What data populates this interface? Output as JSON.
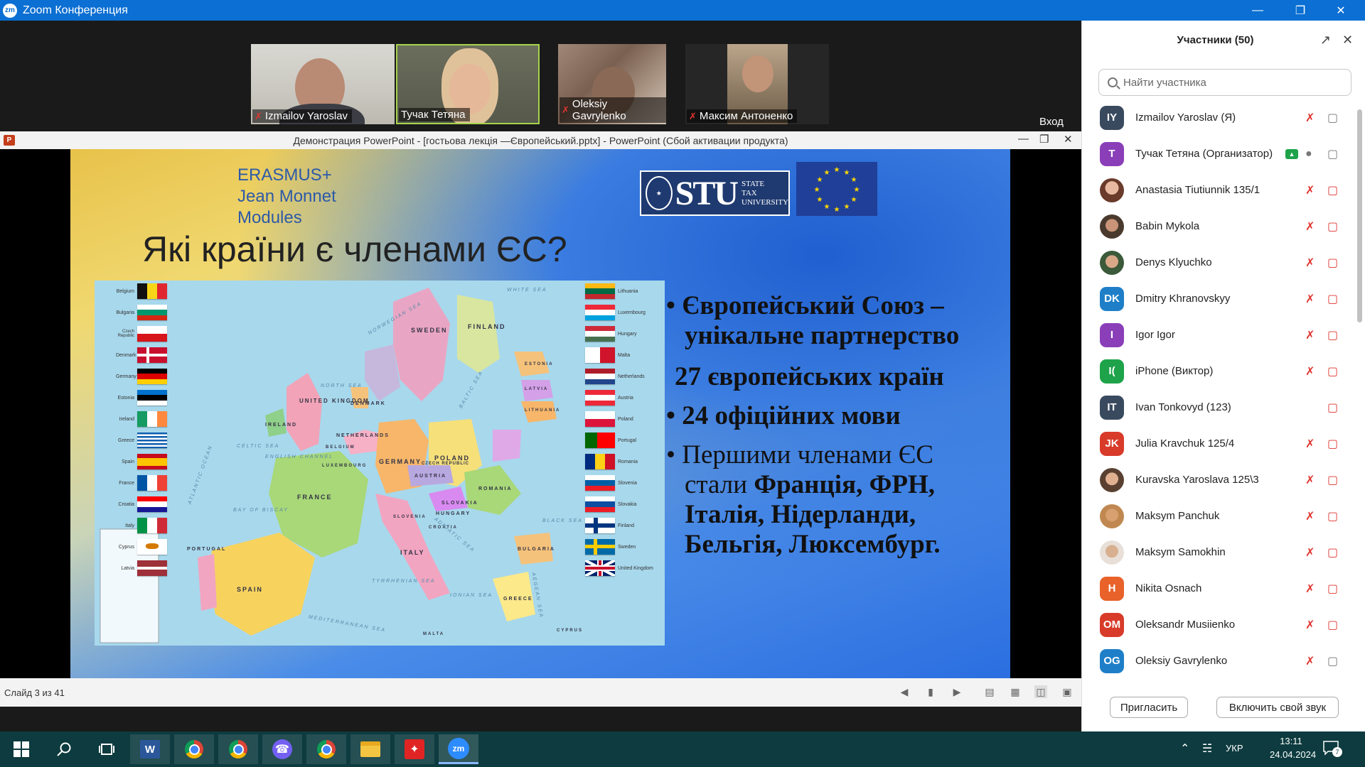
{
  "window": {
    "title": "Zoom Конференция",
    "logo": "zm"
  },
  "videos": [
    {
      "name": "Izmailov Yaroslav",
      "muted": true
    },
    {
      "name": "Тучак Тетяна",
      "muted": false
    },
    {
      "name": "Oleksiy Gavrylenko",
      "muted": true
    },
    {
      "name": "Максим Антоненко",
      "muted": true
    }
  ],
  "vhod_label": "Вход",
  "ppt": {
    "window_title": "Демонстрация PowerPoint - [гостьова лекція —Європейський.pptx] - PowerPoint (Сбой активации продукта)",
    "status": "Слайд 3 из 41"
  },
  "slide": {
    "erasmus_lines": [
      "ERASMUS+",
      "Jean Monnet",
      "Modules"
    ],
    "title": "Які країни є членами ЄС?",
    "logo": {
      "big": "STU",
      "small": [
        "STATE",
        "TAX",
        "UNIVERSITY"
      ]
    },
    "bullets": [
      {
        "marker": "•",
        "lines": [
          "Європейський Союз –",
          "унікальне партнерство"
        ]
      },
      {
        "marker": "",
        "lines": [
          "27 європейських країн"
        ]
      },
      {
        "marker": "•",
        "lines": [
          "24 офіційних мови"
        ]
      },
      {
        "marker": "•",
        "lines_plain": [
          "Першими членами ЄС",
          "стали "
        ],
        "bold_parts": [
          "Франція, ФРН,",
          "Італія, Нідерланди,",
          "Бельгія, Люксембург."
        ]
      }
    ],
    "flags_left": [
      "Belgium",
      "Bulgaria",
      "Czech Republic",
      "Denmark",
      "Germany",
      "Estonia",
      "Ireland",
      "Greece",
      "Spain",
      "France",
      "Croatia",
      "Italy",
      "Cyprus",
      "Latvia"
    ],
    "flags_right": [
      "Lithuania",
      "Luxembourg",
      "Hungary",
      "Malta",
      "Netherlands",
      "Austria",
      "Poland",
      "Portugal",
      "Romania",
      "Slovenia",
      "Slovakia",
      "Finland",
      "Sweden",
      "United Kingdom"
    ],
    "map_countries": [
      "SWEDEN",
      "FINLAND",
      "UNITED KINGDOM",
      "IRELAND",
      "DENMARK",
      "NETHERLANDS",
      "GERMANY",
      "POLAND",
      "FRANCE",
      "SPAIN",
      "PORTUGAL",
      "ITALY",
      "AUSTRIA",
      "CZECH REPUBLIC",
      "SLOVAKIA",
      "HUNGARY",
      "ROMANIA",
      "BULGARIA",
      "GREECE",
      "ESTONIA",
      "LATVIA",
      "LITHUANIA",
      "BELGIUM",
      "CROATIA",
      "SLOVENIA",
      "LUXEMBOURG",
      "MALTA",
      "CYPRUS"
    ],
    "map_seas": [
      "NORWEGIAN SEA",
      "NORTH SEA",
      "ATLANTIC OCEAN",
      "BALTIC SEA",
      "MEDITERRANEAN SEA",
      "BLACK SEA",
      "IONIAN SEA",
      "TYRRHENIAN SEA",
      "ADRIATIC SEA",
      "BAY OF BISCAY",
      "ENGLISH CHANNEL",
      "CELTIC SEA",
      "WHITE SEA",
      "AEGEAN SEA"
    ]
  },
  "participants_panel": {
    "title": "Участники (50)",
    "search_placeholder": "Найти участника",
    "invite_label": "Пригласить",
    "unmute_label": "Включить свой звук",
    "list": [
      {
        "initials": "IY",
        "name": "Izmailov Yaroslav (Я)",
        "color": "#3a4a5e",
        "mic": "muted",
        "cam": "gray"
      },
      {
        "initials": "T",
        "name": "Тучак Тетяна (Организатор)",
        "color": "#8a3fb8",
        "mic": "gray",
        "cam": "gray",
        "sharing": true
      },
      {
        "initials": "",
        "name": "Anastasia Tiutiunnik 135/1",
        "color": "#a86d5a",
        "mic": "muted",
        "cam": "off",
        "photo": true
      },
      {
        "initials": "",
        "name": "Babin Mykola",
        "color": "#6b5a48",
        "mic": "muted",
        "cam": "off",
        "photo": true
      },
      {
        "initials": "",
        "name": "Denys Klyuchko",
        "color": "#7a6550",
        "mic": "muted",
        "cam": "off",
        "photo": true
      },
      {
        "initials": "DK",
        "name": "Dmitry Khranovskyy",
        "color": "#1e7fc8",
        "mic": "muted",
        "cam": "off"
      },
      {
        "initials": "I",
        "name": "Igor Igor",
        "color": "#8a3fb8",
        "mic": "muted",
        "cam": "off"
      },
      {
        "initials": "I(",
        "name": "iPhone (Виктор)",
        "color": "#1ea34a",
        "mic": "muted",
        "cam": "off"
      },
      {
        "initials": "IT",
        "name": "Ivan Tonkovyd (123)",
        "color": "#3a4a5e",
        "mic": "none",
        "cam": "off"
      },
      {
        "initials": "JK",
        "name": "Julia Kravchuk 125/4",
        "color": "#d83b2a",
        "mic": "muted",
        "cam": "off"
      },
      {
        "initials": "",
        "name": "Kuravska Yaroslava 125\\3",
        "color": "#8a6a58",
        "mic": "muted",
        "cam": "off",
        "photo": true
      },
      {
        "initials": "",
        "name": "Maksym Panchuk",
        "color": "#b07a50",
        "mic": "muted",
        "cam": "off",
        "photo": true
      },
      {
        "initials": "",
        "name": "Maksym Samokhin",
        "color": "#9a7a62",
        "mic": "muted",
        "cam": "off",
        "photo": true
      },
      {
        "initials": "H",
        "name": "Nikita Osnach",
        "color": "#e8622a",
        "mic": "muted",
        "cam": "off"
      },
      {
        "initials": "OM",
        "name": "Oleksandr Musiienko",
        "color": "#d83b2a",
        "mic": "muted",
        "cam": "off"
      },
      {
        "initials": "OG",
        "name": "Oleksiy Gavrylenko",
        "color": "#1e7fc8",
        "mic": "muted",
        "cam": "gray"
      }
    ]
  },
  "taskbar": {
    "lang": "УКР",
    "time": "13:11",
    "date": "24.04.2024",
    "notifications": "7",
    "apps": [
      "start",
      "search",
      "task-view",
      "word",
      "chrome",
      "chrome-2",
      "viber",
      "chrome-3",
      "explorer",
      "acrobat",
      "zoom"
    ]
  }
}
